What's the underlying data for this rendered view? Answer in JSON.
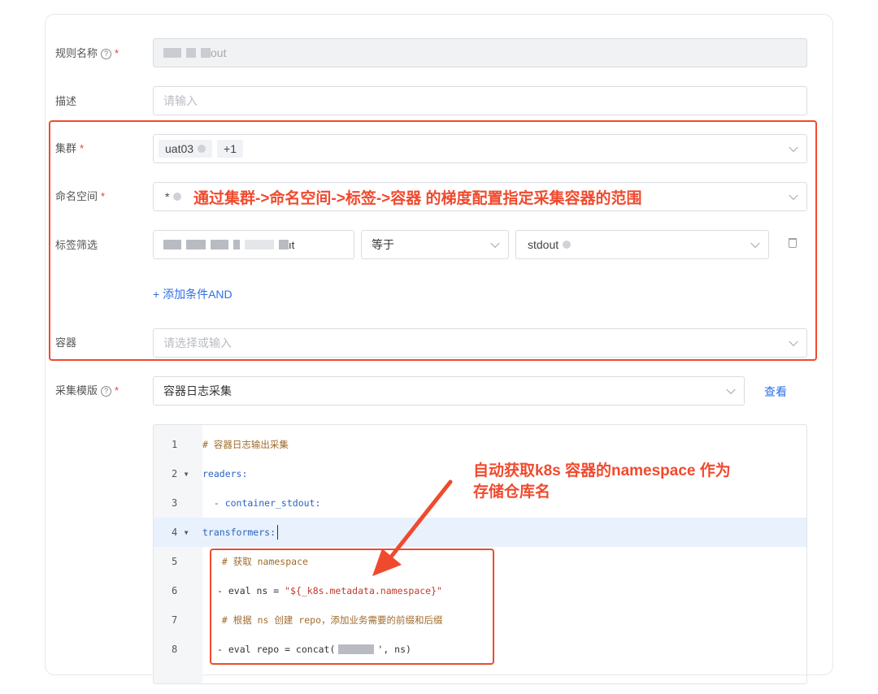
{
  "form": {
    "rule_name": {
      "label": "规则名称",
      "value_suffix": "out"
    },
    "description": {
      "label": "描述",
      "placeholder": "请输入"
    },
    "cluster": {
      "label": "集群",
      "tag": "uat03",
      "extra": "+1"
    },
    "namespace": {
      "label": "命名空间",
      "tag": "*"
    },
    "label_filter": {
      "label": "标签筛选",
      "key_suffix": "ıt",
      "operator": "等于",
      "value_tag": "stdout"
    },
    "add_condition": "+ 添加条件AND",
    "container": {
      "label": "容器",
      "placeholder": "请选择或输入"
    },
    "template": {
      "label": "采集模版",
      "value": "容器日志采集",
      "view_link": "查看"
    },
    "required_mark": "*",
    "help_mark": "?"
  },
  "annotations": {
    "scope": "通过集群->命名空间->标签->容器 的梯度配置指定采集容器的范围",
    "namespace_repo_line1": "自动获取k8s 容器的namespace 作为",
    "namespace_repo_line2": "存储仓库名"
  },
  "editor": {
    "lines": [
      {
        "num": "1",
        "text": "# 容器日志输出采集"
      },
      {
        "num": "2 ▾",
        "text": "readers:"
      },
      {
        "num": "3",
        "text": "  - container_stdout:"
      },
      {
        "num": "4 ▾",
        "text": "transformers:"
      },
      {
        "num": "5",
        "text": "  # 获取 namespace"
      },
      {
        "num": "6",
        "text": "- eval ns = ",
        "str": "\"${_k8s.metadata.namespace}\""
      },
      {
        "num": "7",
        "text": "  # 根据 ns 创建 repo，添加业务需要的前缀和后缀"
      },
      {
        "num": "8",
        "text": "- eval repo = concat(",
        "text_after": "', ns)"
      }
    ]
  },
  "colors": {
    "accent": "#2f6fe6",
    "annotation": "#f04a2e",
    "required": "#e23d3d"
  }
}
